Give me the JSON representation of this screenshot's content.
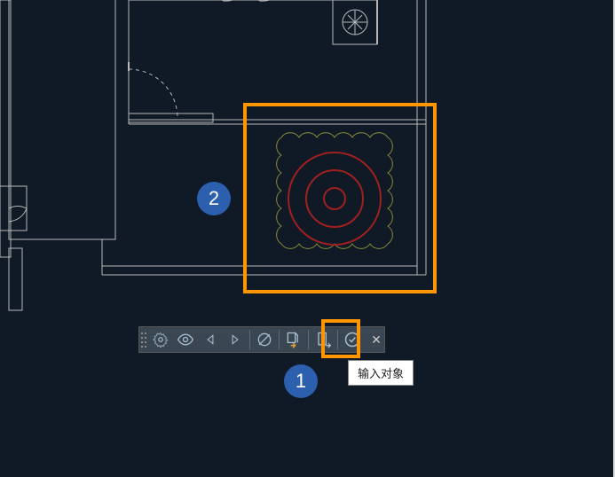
{
  "callouts": {
    "badge1": "1",
    "badge2": "2"
  },
  "tooltip": {
    "text": "输入对象"
  },
  "toolbar": {
    "buttons": [
      {
        "name": "settings",
        "icon": "gear"
      },
      {
        "name": "visibility",
        "icon": "eye"
      },
      {
        "name": "prev",
        "icon": "triangle-left"
      },
      {
        "name": "next",
        "icon": "triangle-right"
      },
      {
        "name": "no-preview",
        "icon": "eye-slash"
      },
      {
        "name": "import-object",
        "icon": "file-import",
        "highlighted": true
      },
      {
        "name": "export",
        "icon": "file-export"
      },
      {
        "name": "confirm",
        "icon": "check-circle"
      }
    ],
    "close_label": "✕"
  },
  "highlight": {
    "color": "#ff9500"
  }
}
